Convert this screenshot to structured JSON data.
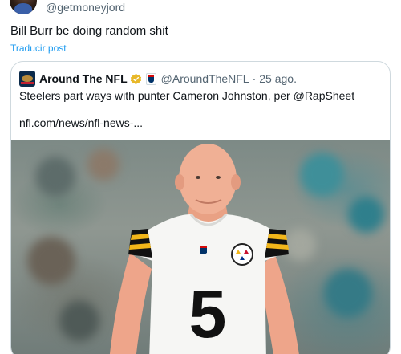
{
  "tweet": {
    "handle": "@getmoneyjord",
    "text": "Bill Burr be doing random shit",
    "translate_label": "Traducir post"
  },
  "quote": {
    "name": "Around The NFL",
    "handle": "@AroundTheNFL",
    "separator": "·",
    "time": "25 ago.",
    "text": "Steelers part ways with punter Cameron Johnston, per @RapSheet",
    "link": "nfl.com/news/nfl-news-...",
    "jersey_number": "5"
  },
  "colors": {
    "link": "#1d9bf0",
    "verified": "#e8b829",
    "text": "#0f1419",
    "secondary": "#536471"
  },
  "icons": {
    "verified": "verified-gold-badge-icon",
    "affiliate": "nfl-affiliate-badge-icon"
  }
}
